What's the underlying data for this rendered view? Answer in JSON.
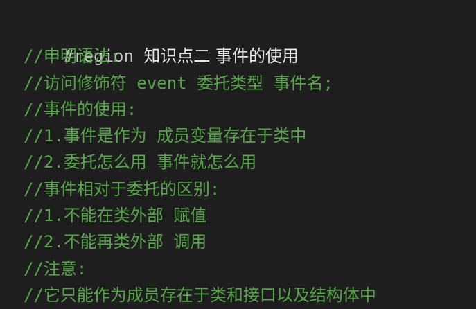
{
  "editor": {
    "region_keyword": "#region ",
    "region_name": "知识点二 事件的使用",
    "comment_lines": [
      "//申明语法:",
      "//访问修饰符 event 委托类型 事件名;",
      "//事件的使用:",
      "//1.事件是作为 成员变量存在于类中",
      "//2.委托怎么用 事件就怎么用",
      "//事件相对于委托的区别:",
      "//1.不能在类外部 赋值",
      "//2.不能再类外部 调用",
      "//注意:",
      "//它只能作为成员存在于类和接口以及结构体中"
    ],
    "colors": {
      "background": "#1e1e1e",
      "comment": "#57a64a",
      "directive": "#c5c5c5",
      "text": "#e6e6e6"
    }
  }
}
